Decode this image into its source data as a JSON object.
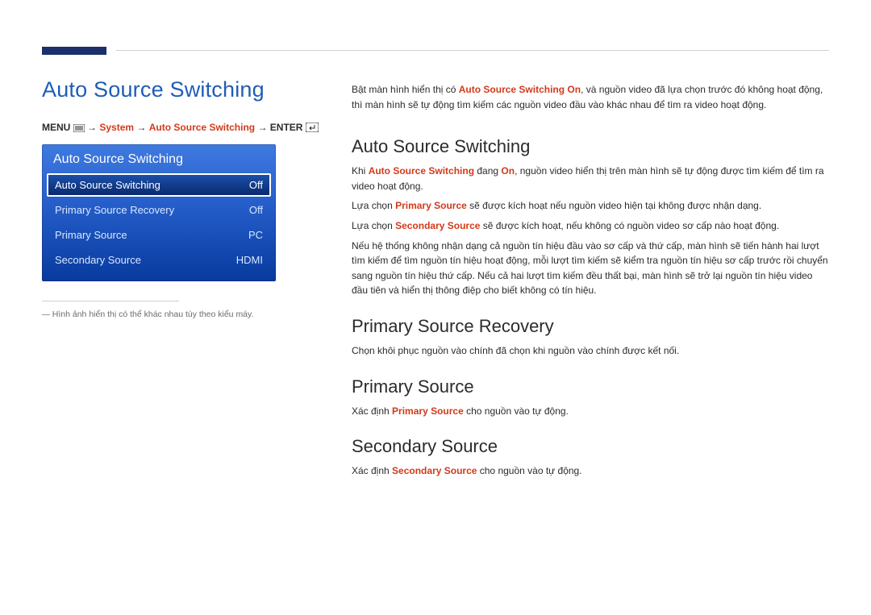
{
  "page": {
    "title": "Auto Source Switching",
    "breadcrumb": {
      "menu": "MENU",
      "arrow": "→",
      "path1": "System",
      "path2": "Auto Source Switching",
      "enter": "ENTER"
    }
  },
  "osd": {
    "header": "Auto Source Switching",
    "rows": [
      {
        "label": "Auto Source Switching",
        "value": "Off",
        "selected": true
      },
      {
        "label": "Primary Source Recovery",
        "value": "Off",
        "selected": false
      },
      {
        "label": "Primary Source",
        "value": "PC",
        "selected": false
      },
      {
        "label": "Secondary Source",
        "value": "HDMI",
        "selected": false
      }
    ]
  },
  "footnote": "Hình ảnh hiển thị có thể khác nhau tùy theo kiểu máy.",
  "intro": {
    "p1_pre": "Bật màn hình hiển thị có ",
    "p1_term": "Auto Source Switching On",
    "p1_post": ", và nguồn video đã lựa chọn trước đó không hoạt động, thì màn hình sẽ tự động tìm kiếm các nguồn video đầu vào khác nhau để tìm ra video hoạt động."
  },
  "sections": {
    "s1": {
      "heading": "Auto Source Switching",
      "p1_pre": "Khi ",
      "p1_term1": "Auto Source Switching",
      "p1_mid": " đang ",
      "p1_term2": "On",
      "p1_post": ", nguồn video hiển thị trên màn hình sẽ tự động được tìm kiếm để tìm ra video hoạt động.",
      "p2_pre": "Lựa chọn ",
      "p2_term": "Primary Source",
      "p2_post": " sẽ được kích hoạt nếu nguồn video hiện tại không được nhận dạng.",
      "p3_pre": "Lựa chọn ",
      "p3_term": "Secondary Source",
      "p3_post": " sẽ được kích hoạt, nếu không có nguồn video sơ cấp nào hoạt động.",
      "p4": "Nếu hệ thống không nhận dạng cả nguồn tín hiệu đầu vào sơ cấp và thứ cấp, màn hình sẽ tiến hành hai lượt tìm kiếm để tìm nguồn tín hiệu hoạt động, mỗi lượt tìm kiếm sẽ kiểm tra nguồn tín hiệu sơ cấp trước rồi chuyển sang nguồn tín hiệu thứ cấp. Nếu cả hai lượt tìm kiếm đều thất bại, màn hình sẽ trở lại nguồn tín hiệu video đầu tiên và hiển thị thông điệp cho biết không có tín hiệu."
    },
    "s2": {
      "heading": "Primary Source Recovery",
      "p1": "Chọn khôi phục nguồn vào chính đã chọn khi nguồn vào chính được kết nối."
    },
    "s3": {
      "heading": "Primary Source",
      "p1_pre": "Xác định ",
      "p1_term": "Primary Source",
      "p1_post": " cho nguồn vào tự động."
    },
    "s4": {
      "heading": "Secondary Source",
      "p1_pre": "Xác định ",
      "p1_term": "Secondary Source",
      "p1_post": " cho nguồn vào tự động."
    }
  }
}
